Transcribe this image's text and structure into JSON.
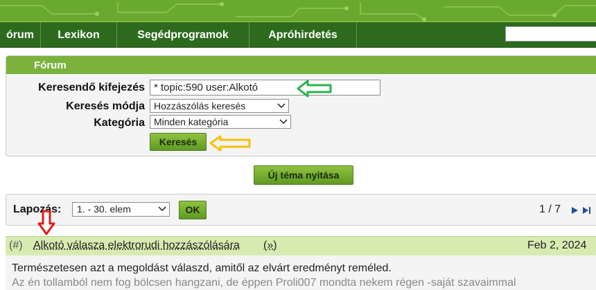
{
  "nav": {
    "items": [
      {
        "label": "órum"
      },
      {
        "label": "Lexikon"
      },
      {
        "label": "Segédprogramok"
      },
      {
        "label": "Apróhirdetés"
      }
    ],
    "search_value": ""
  },
  "search_panel": {
    "title": "Fórum",
    "query_label": "Keresendő kifejezés",
    "query_value": "* topic:590 user:Alkotó",
    "mode_label": "Keresés módja",
    "mode_value": "Hozzászólás keresés",
    "category_label": "Kategória",
    "category_value": "Minden kategória",
    "search_button": "Keresés"
  },
  "new_topic_button": "Új téma nyitása",
  "pager": {
    "label": "Lapozás:",
    "range_value": "1. - 30. elem",
    "ok_button": "OK",
    "page_count": "1 / 7"
  },
  "post": {
    "anchor": "(#)",
    "title": "Alkotó válasza elektrorudi hozzászólására",
    "reply_link": "(»)",
    "date": "Feb 2, 2024",
    "body_line1": "Természetesen azt a megoldást válaszd, amitől az elvárt eredményt reméled.",
    "body_line2": "Az én tollamból nem fog bölcsen hangzani, de éppen Proli007 mondta nekem régen -saját szavaimmal"
  },
  "colors": {
    "nav_bg": "#2d6a1e",
    "panel_header": "#7ab23c",
    "post_header": "#d7ebb1",
    "annotation_green": "#2bb24c",
    "annotation_yellow": "#f5c10a",
    "annotation_red": "#e01b1b"
  }
}
